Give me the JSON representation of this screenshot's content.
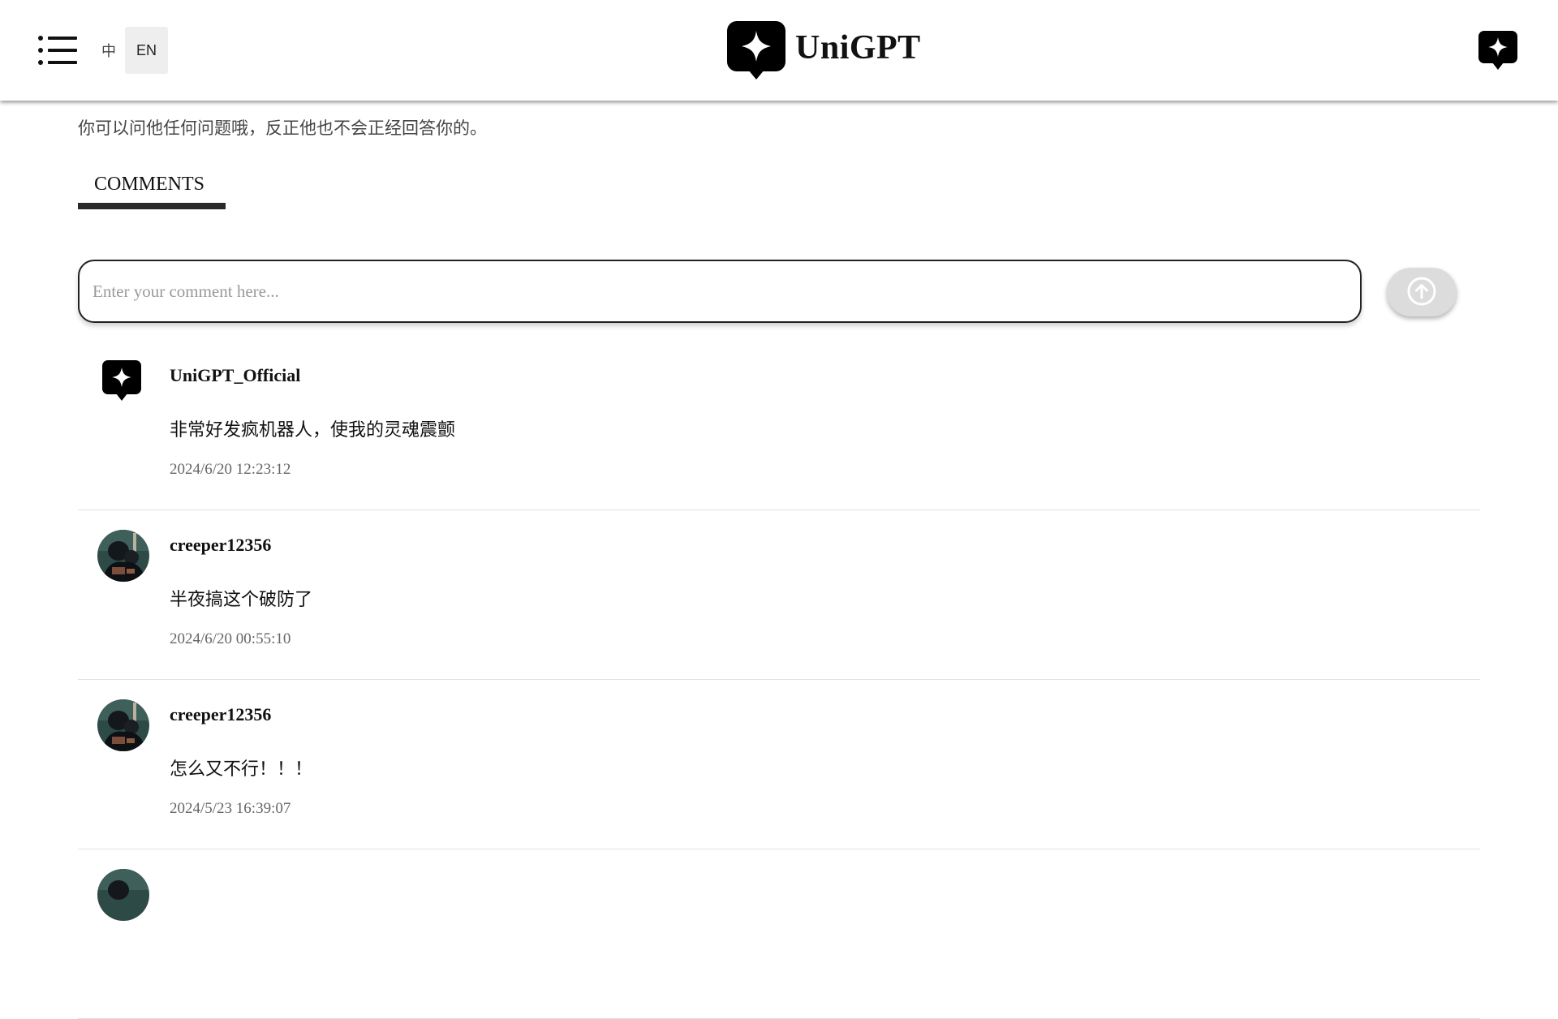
{
  "header": {
    "menu_icon": "list-icon",
    "lang_zh": "中",
    "lang_en": "EN",
    "brand_name": "UniGPT",
    "brand_icon": "sparkle-chat-bubble-icon",
    "new_chat_icon": "sparkle-chat-bubble-icon"
  },
  "main": {
    "description": "你可以问他任何问题哦，反正他也不会正经回答你的。",
    "tab_label": "COMMENTS",
    "comment_placeholder": "Enter your comment here...",
    "submit_icon": "arrow-up-circle-icon"
  },
  "comments": [
    {
      "user": "UniGPT_Official",
      "text": "非常好发疯机器人，使我的灵魂震颤",
      "time": "2024/6/20 12:23:12",
      "avatar": "sparkle-chat-bubble-icon"
    },
    {
      "user": "creeper12356",
      "text": "半夜搞这个破防了",
      "time": "2024/6/20 00:55:10",
      "avatar": "photo-avatar"
    },
    {
      "user": "creeper12356",
      "text": "怎么又不行！！！",
      "time": "2024/5/23 16:39:07",
      "avatar": "photo-avatar"
    }
  ],
  "colors": {
    "accent": "#000000",
    "active_lang_bg": "#eeeeee",
    "submit_bg": "#dcdcdc"
  }
}
